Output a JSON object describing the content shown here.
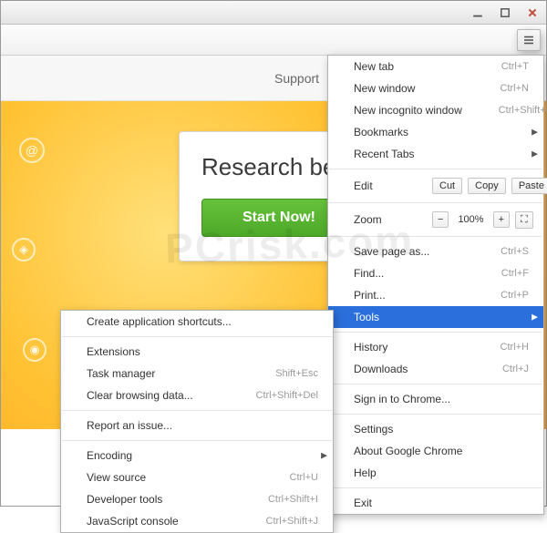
{
  "window": {
    "min": "—",
    "max": "▢",
    "close": "×"
  },
  "nav": {
    "support": "Support"
  },
  "hero": {
    "heading": "Research better\nQWebber!",
    "start": "Start Now!"
  },
  "mainMenu": {
    "newTab": {
      "label": "New tab",
      "shortcut": "Ctrl+T"
    },
    "newWindow": {
      "label": "New window",
      "shortcut": "Ctrl+N"
    },
    "newIncog": {
      "label": "New incognito window",
      "shortcut": "Ctrl+Shift+N"
    },
    "bookmarks": {
      "label": "Bookmarks"
    },
    "recentTabs": {
      "label": "Recent Tabs"
    },
    "edit": {
      "label": "Edit",
      "cut": "Cut",
      "copy": "Copy",
      "paste": "Paste"
    },
    "zoom": {
      "label": "Zoom",
      "minus": "−",
      "value": "100%",
      "plus": "+",
      "full": "⛶"
    },
    "saveAs": {
      "label": "Save page as...",
      "shortcut": "Ctrl+S"
    },
    "find": {
      "label": "Find...",
      "shortcut": "Ctrl+F"
    },
    "print": {
      "label": "Print...",
      "shortcut": "Ctrl+P"
    },
    "tools": {
      "label": "Tools"
    },
    "history": {
      "label": "History",
      "shortcut": "Ctrl+H"
    },
    "downloads": {
      "label": "Downloads",
      "shortcut": "Ctrl+J"
    },
    "signIn": {
      "label": "Sign in to Chrome..."
    },
    "settings": {
      "label": "Settings"
    },
    "about": {
      "label": "About Google Chrome"
    },
    "help": {
      "label": "Help"
    },
    "exit": {
      "label": "Exit"
    }
  },
  "toolsMenu": {
    "createShortcut": {
      "label": "Create application shortcuts..."
    },
    "extensions": {
      "label": "Extensions"
    },
    "taskManager": {
      "label": "Task manager",
      "shortcut": "Shift+Esc"
    },
    "clearData": {
      "label": "Clear browsing data...",
      "shortcut": "Ctrl+Shift+Del"
    },
    "reportIssue": {
      "label": "Report an issue..."
    },
    "encoding": {
      "label": "Encoding"
    },
    "viewSource": {
      "label": "View source",
      "shortcut": "Ctrl+U"
    },
    "devTools": {
      "label": "Developer tools",
      "shortcut": "Ctrl+Shift+I"
    },
    "jsConsole": {
      "label": "JavaScript console",
      "shortcut": "Ctrl+Shift+J"
    }
  },
  "watermark": "PCrisk.com"
}
